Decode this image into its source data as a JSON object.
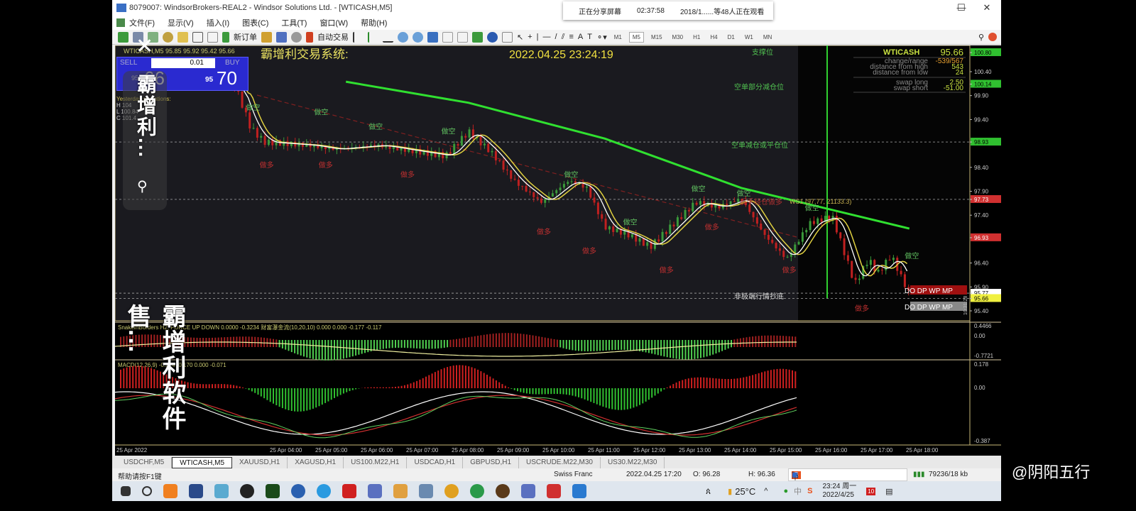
{
  "window": {
    "title": "8079007: WindsorBrokers-REAL2 - Windsor Solutions Ltd. - [WTICASH,M5]",
    "minimize": "—",
    "maximize": "☐",
    "close": "✕"
  },
  "share_popup": {
    "status": "正在分享屏幕",
    "elapsed": "02:37:58",
    "viewers": "2018/1......等48人正在观看"
  },
  "menu": [
    "文件(F)",
    "显示(V)",
    "插入(I)",
    "图表(C)",
    "工具(T)",
    "窗口(W)",
    "帮助(H)"
  ],
  "toolbar": {
    "new_order": "新订单",
    "auto_trade": "自动交易",
    "timeframes": [
      "M1",
      "M5",
      "M15",
      "M30",
      "H1",
      "H4",
      "D1",
      "W1",
      "MN"
    ],
    "active_timeframe": "M5"
  },
  "chart": {
    "header": "WTICASH,M5  95.85 95.92 95.42 95.66",
    "system_title": "霸增利交易系统:",
    "datetime": "2022.04.25 23:24:19",
    "trade_panel": {
      "sell": "SELL",
      "buy": "BUY",
      "lot": "0.01",
      "sell_price_small": "95",
      "sell_price_big": "66",
      "buy_price_small": "95",
      "buy_price_big": "70"
    },
    "yesterday": {
      "title": "Yesterday quotations:",
      "h": "H 104",
      "l": "L 100.84",
      "c": "C 101.4"
    },
    "info": {
      "symbol": "WTICASH",
      "price": "95.66",
      "change_label": "change/range",
      "change": "-539/567",
      "dist_high_label": "distance from high",
      "dist_high": "543",
      "dist_low_label": "distance from low",
      "dist_low": "24",
      "swap_long_label": "swap long",
      "swap_long": "2.50",
      "swap_short_label": "swap short",
      "swap_short": "-51.00"
    },
    "levels": {
      "support": "支撑位",
      "l1": "空单部分减仓位",
      "l2": "空单减仓或平仓位",
      "l3": "反手轻仓做多",
      "ws1": "WS1  (97.77, 21133.3)",
      "l4": "非极端行情抄底"
    },
    "dodp": "DO DP WP MP",
    "side_label": "10:31:28",
    "signals": {
      "short": "做空",
      "long": "做多"
    },
    "price_axis": [
      {
        "v": "100.80",
        "hl": "green"
      },
      {
        "v": "100.40"
      },
      {
        "v": "100.14",
        "hl": "green"
      },
      {
        "v": "99.90"
      },
      {
        "v": "99.40"
      },
      {
        "v": "98.93",
        "hl": "green"
      },
      {
        "v": "98.40"
      },
      {
        "v": "97.90"
      },
      {
        "v": "97.73",
        "hl": "red"
      },
      {
        "v": "97.40"
      },
      {
        "v": "96.93",
        "hl": "red"
      },
      {
        "v": "96.40"
      },
      {
        "v": "95.90"
      },
      {
        "v": "95.77",
        "hl": "white"
      },
      {
        "v": "95.66",
        "hl": "yellow"
      },
      {
        "v": "95.40"
      }
    ],
    "price_path": [
      [
        2.8,
        100.27
      ],
      [
        3.2,
        99.23
      ],
      [
        3.5,
        98.93
      ],
      [
        4.5,
        98.86
      ],
      [
        5.0,
        98.78
      ],
      [
        6.0,
        98.86
      ],
      [
        7.0,
        98.71
      ],
      [
        7.5,
        98.64
      ],
      [
        8.0,
        99.15
      ],
      [
        8.5,
        98.71
      ],
      [
        9.0,
        98.12
      ],
      [
        9.6,
        97.67
      ],
      [
        10.2,
        98.12
      ],
      [
        10.6,
        97.97
      ],
      [
        11.0,
        97.15
      ],
      [
        11.5,
        97.0
      ],
      [
        12.0,
        96.74
      ],
      [
        12.6,
        97.3
      ],
      [
        13.0,
        97.67
      ],
      [
        13.5,
        97.57
      ],
      [
        14.0,
        97.75
      ],
      [
        14.5,
        97.0
      ],
      [
        15.0,
        96.48
      ],
      [
        15.5,
        97.23
      ],
      [
        16.0,
        97.38
      ],
      [
        16.5,
        95.96
      ],
      [
        16.8,
        96.48
      ],
      [
        17.0,
        96.18
      ],
      [
        17.3,
        96.56
      ],
      [
        17.7,
        95.74
      ]
    ],
    "ma_path": [
      [
        5.3,
        100.19
      ],
      [
        8,
        99.75
      ],
      [
        11,
        99.0
      ],
      [
        14,
        97.97
      ],
      [
        17.7,
        97.12
      ]
    ],
    "ind1": {
      "label": "SnakeInBorders H2, FORCE UP  DOWN  0.0000 -0.3234  财富瀑金流(10,20,10) 0.000 0.000 -0.177 -0.117",
      "max": "0.4466",
      "zero": "0.00",
      "min": "-0.7721"
    },
    "ind2": {
      "label": "MACD(12,26,9) -0.224 -0.170 0.000 -0.071",
      "max": "0.178",
      "zero": "0.00",
      "min": "-0.387"
    },
    "time_axis": [
      "25 Apr 2022",
      "25 Apr 04:00",
      "25 Apr 05:00",
      "25 Apr 06:00",
      "25 Apr 07:00",
      "25 Apr 08:00",
      "25 Apr 09:00",
      "25 Apr 10:00",
      "25 Apr 11:00",
      "25 Apr 12:00",
      "25 Apr 13:00",
      "25 Apr 14:00",
      "25 Apr 15:00",
      "25 Apr 16:00",
      "25 Apr 17:00",
      "25 Apr 18:00"
    ]
  },
  "tabs": [
    "USDCHF,M5",
    "WTICASH,M5",
    "XAUUSD,H1",
    "XAGUSD,H1",
    "US100.M22,H1",
    "USDCAD,H1",
    "GBPUSD,H1",
    "USCRUDE.M22,M30",
    "US30.M22,M30"
  ],
  "active_tab": "WTICASH,M5",
  "status": {
    "help": "帮助请按F1键",
    "symbol": "Swiss Franc",
    "time": "2022.04.25 17:20",
    "open": "O: 96.28",
    "high": "H: 96.36",
    "traffic": "79236/18 kb"
  },
  "taskbar": {
    "weather": "25°C",
    "ime": "中",
    "clock_time": "23:24 周一",
    "clock_date": "2022/4/25",
    "notif": "10"
  },
  "overlay": {
    "close": "✕",
    "caption_top": "霸增利...",
    "caption_bottom": "霸增利软件售..."
  },
  "watermark": "@阴阳五行"
}
